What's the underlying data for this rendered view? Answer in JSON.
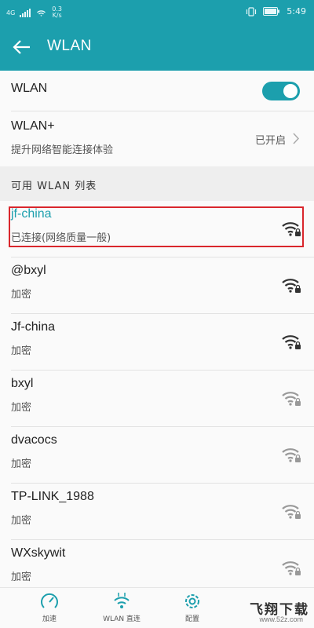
{
  "status_bar": {
    "network_type": "4G",
    "speed_value": "0.3",
    "speed_unit": "K/s",
    "time": "5:49"
  },
  "app_bar": {
    "title": "WLAN"
  },
  "wlan_toggle": {
    "label": "WLAN",
    "on": true
  },
  "wlan_plus": {
    "title": "WLAN+",
    "subtitle": "提升网络智能连接体验",
    "value": "已开启"
  },
  "section_header": "可用 WLAN 列表",
  "networks": [
    {
      "name": "jf-china",
      "status": "已连接(网络质量一般)",
      "connected": true,
      "signal": "strong"
    },
    {
      "name": "@bxyl",
      "status": "加密",
      "signal": "strong"
    },
    {
      "name": "Jf-china",
      "status": "加密",
      "signal": "strong"
    },
    {
      "name": "bxyl",
      "status": "加密",
      "signal": "weak"
    },
    {
      "name": "dvacocs",
      "status": "加密",
      "signal": "weak"
    },
    {
      "name": "TP-LINK_1988",
      "status": "加密",
      "signal": "weak"
    },
    {
      "name": "WXskywit",
      "status": "加密",
      "signal": "weak"
    }
  ],
  "bottom_tabs": [
    {
      "label": "加速",
      "icon": "speed-gauge-icon"
    },
    {
      "label": "WLAN 直连",
      "icon": "wifi-direct-icon"
    },
    {
      "label": "配置",
      "icon": "gear-icon"
    }
  ],
  "watermark": {
    "title": "飞翔下载",
    "url": "www.52z.com"
  },
  "colors": {
    "accent": "#1c9fad",
    "highlight_border": "#d9262c"
  }
}
